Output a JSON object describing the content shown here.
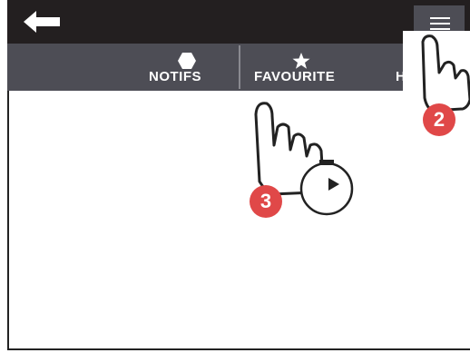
{
  "colors": {
    "topbar": "#231f20",
    "navbar": "#4d4d55",
    "badge": "#e04848",
    "background": "#ffffff"
  },
  "topbar": {
    "back_icon": "back-arrow-icon",
    "menu_icon": "hamburger-menu-icon"
  },
  "nav": {
    "tabs": [
      {
        "label": "NOTIFS",
        "icon": "hexagon-icon"
      },
      {
        "label": "FAVOURITE",
        "icon": "star-icon"
      },
      {
        "label": "H",
        "icon": ""
      }
    ]
  },
  "annotations": {
    "step2": "2",
    "step3": "3",
    "gesture_icon": "tap-hand-icon",
    "hold_icon": "timer-play-icon"
  }
}
